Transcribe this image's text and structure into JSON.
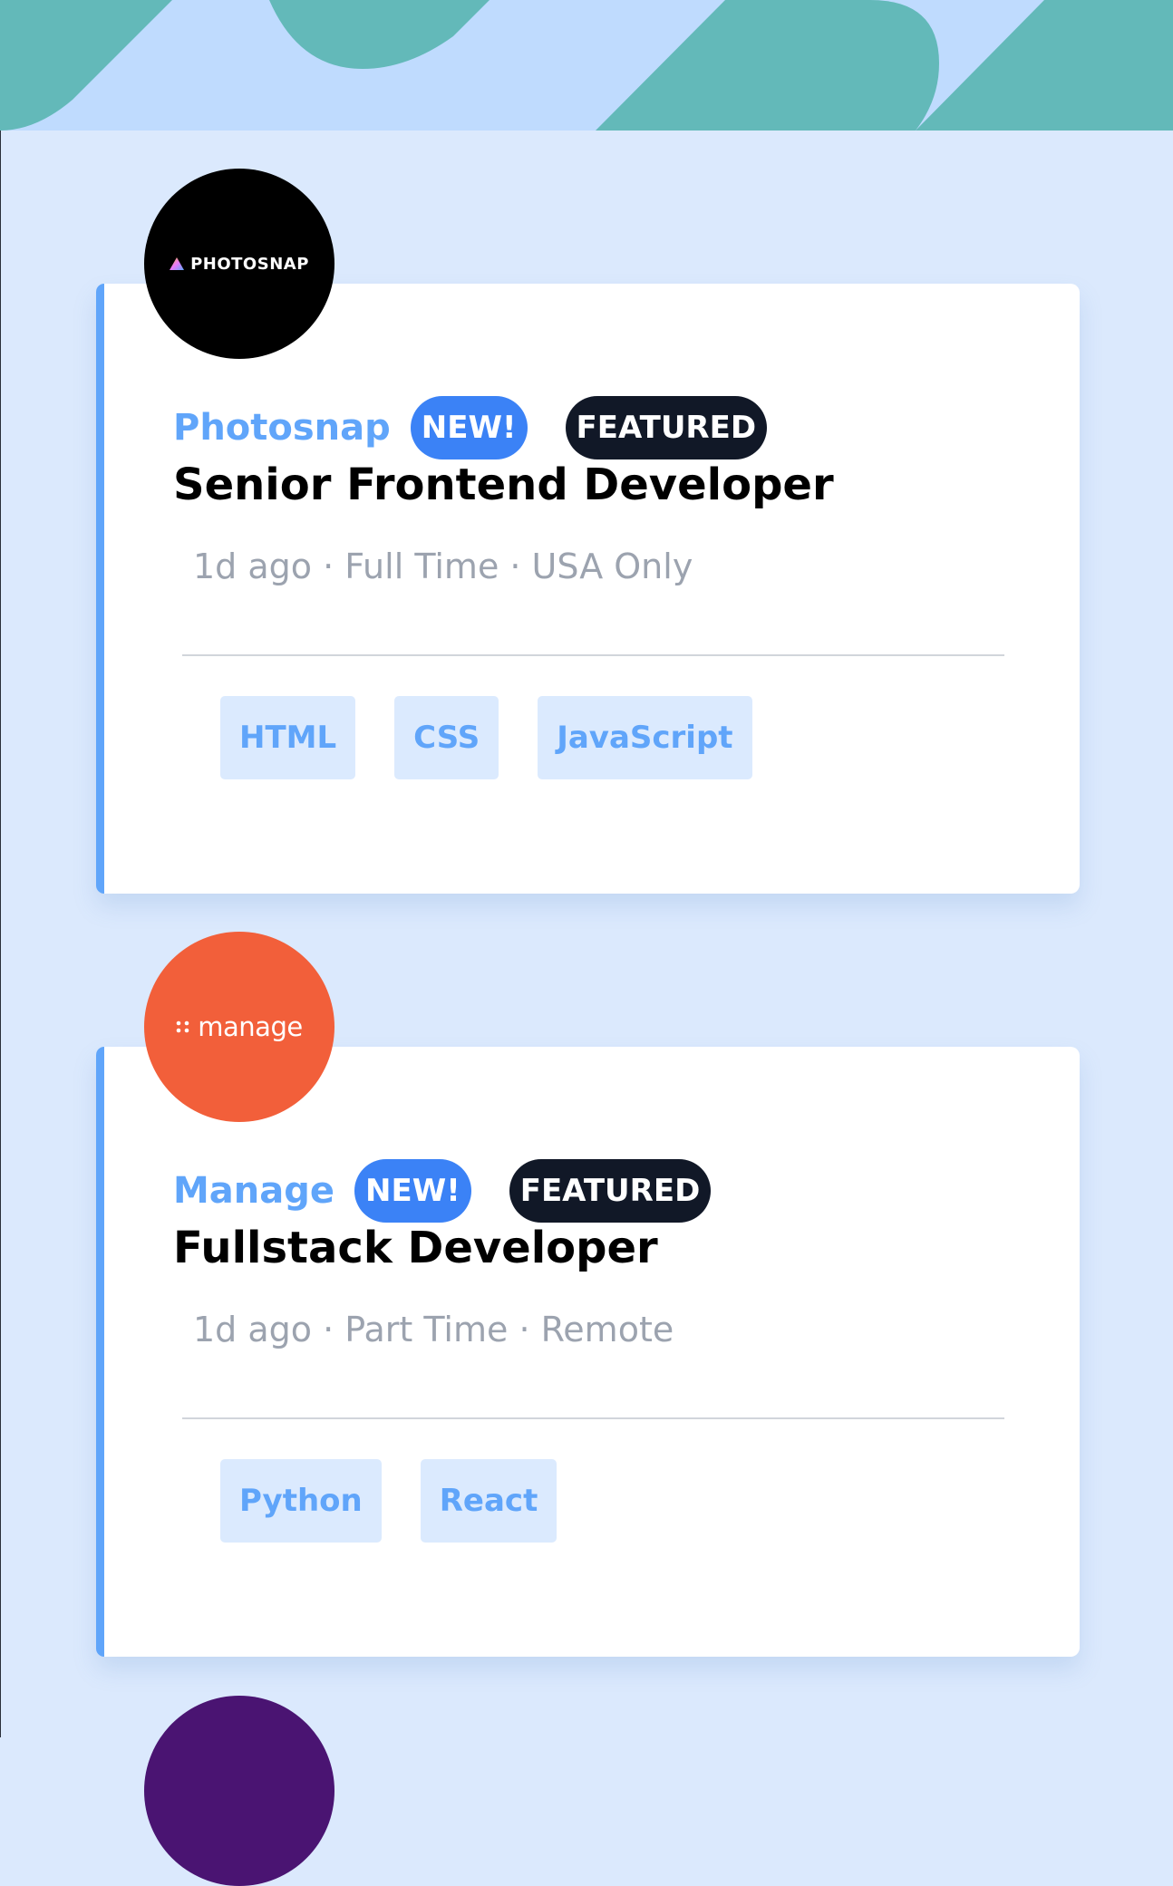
{
  "theme": {
    "background": "#dbe9fd",
    "header_light": "#bfdbfe",
    "header_teal": "#63b9b9",
    "accent_blue": "#60a5fa",
    "badge_new": "#3b82f6",
    "badge_featured": "#111827",
    "tag_bg": "#dbeafe",
    "meta_gray": "#9ca3af"
  },
  "jobs": [
    {
      "logo": {
        "text": "PHOTOSNAP",
        "color": "#000000",
        "icon": "photosnap-triangle-icon"
      },
      "company": "Photosnap",
      "badges": {
        "new": "NEW!",
        "featured": "FEATURED"
      },
      "title": "Senior Frontend Developer",
      "meta": "1d ago · Full Time · USA Only",
      "tags": [
        "HTML",
        "CSS",
        "JavaScript"
      ]
    },
    {
      "logo": {
        "text": "manage",
        "color": "#f25f3a",
        "icon": "manage-dots-icon"
      },
      "company": "Manage",
      "badges": {
        "new": "NEW!",
        "featured": "FEATURED"
      },
      "title": "Fullstack Developer",
      "meta": "1d ago · Part Time · Remote",
      "tags": [
        "Python",
        "React"
      ]
    }
  ],
  "partial_next_logo": {
    "color": "#4a1472"
  }
}
